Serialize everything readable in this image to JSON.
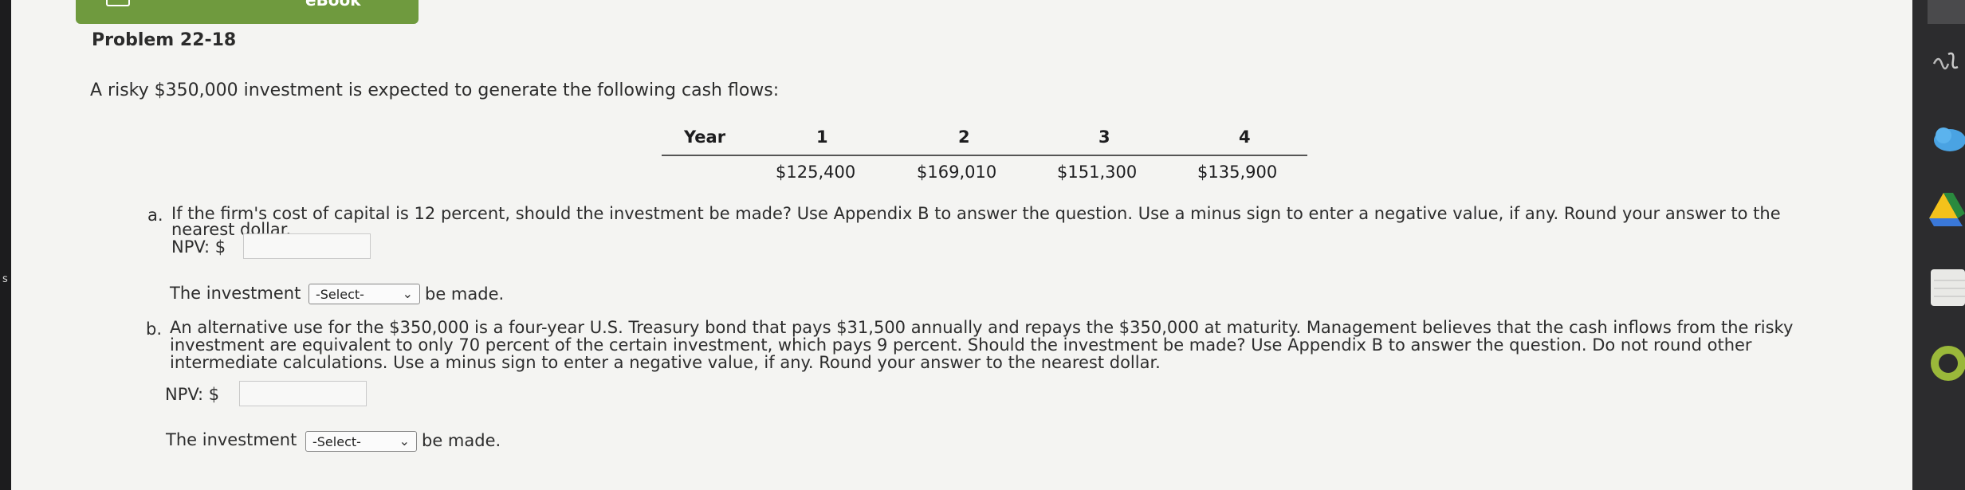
{
  "ebook_tab": {
    "label": "eBook"
  },
  "problem": {
    "title": "Problem 22-18",
    "intro": "A risky $350,000 investment is expected to generate the following cash flows:"
  },
  "cash_flows": {
    "header": [
      "Year",
      "1",
      "2",
      "3",
      "4"
    ],
    "values": [
      "$125,400",
      "$169,010",
      "$151,300",
      "$135,900"
    ]
  },
  "part_a": {
    "letter": "a.",
    "line1": "If the firm's cost of capital is 12 percent, should the investment be made? Use Appendix B to answer the question. Use a minus sign to enter a negative value, if any. Round your answer to the",
    "line2": "nearest dollar.",
    "npv_label": "NPV: $",
    "npv_value": "",
    "investment_prefix": "The investment",
    "select_value": "-Select-",
    "investment_suffix": "be made."
  },
  "part_b": {
    "letter": "b.",
    "line1": "An alternative use for the $350,000 is a four-year U.S. Treasury bond that pays $31,500 annually and repays the $350,000 at maturity. Management believes that the cash inflows from the risky",
    "line2": "investment are equivalent to only 70 percent of the certain investment, which pays 9 percent. Should the investment be made? Use Appendix B to answer the question. Do not round other",
    "line3": "intermediate calculations. Use a minus sign to enter a negative value, if any. Round your answer to the nearest dollar.",
    "npv_label": "NPV: $",
    "npv_value": "",
    "investment_prefix": "The investment",
    "select_value": "-Select-",
    "investment_suffix": "be made."
  },
  "left_edge": {
    "mark": "s"
  },
  "dock": {
    "icons": [
      "siri-icon",
      "cloud-icon",
      "drive-icon",
      "notes-icon",
      "green-app-icon"
    ]
  },
  "colors": {
    "ebook_green": "#6f9a3e",
    "page_bg": "#f4f4f2",
    "dock_bg": "#2c2c2e"
  }
}
